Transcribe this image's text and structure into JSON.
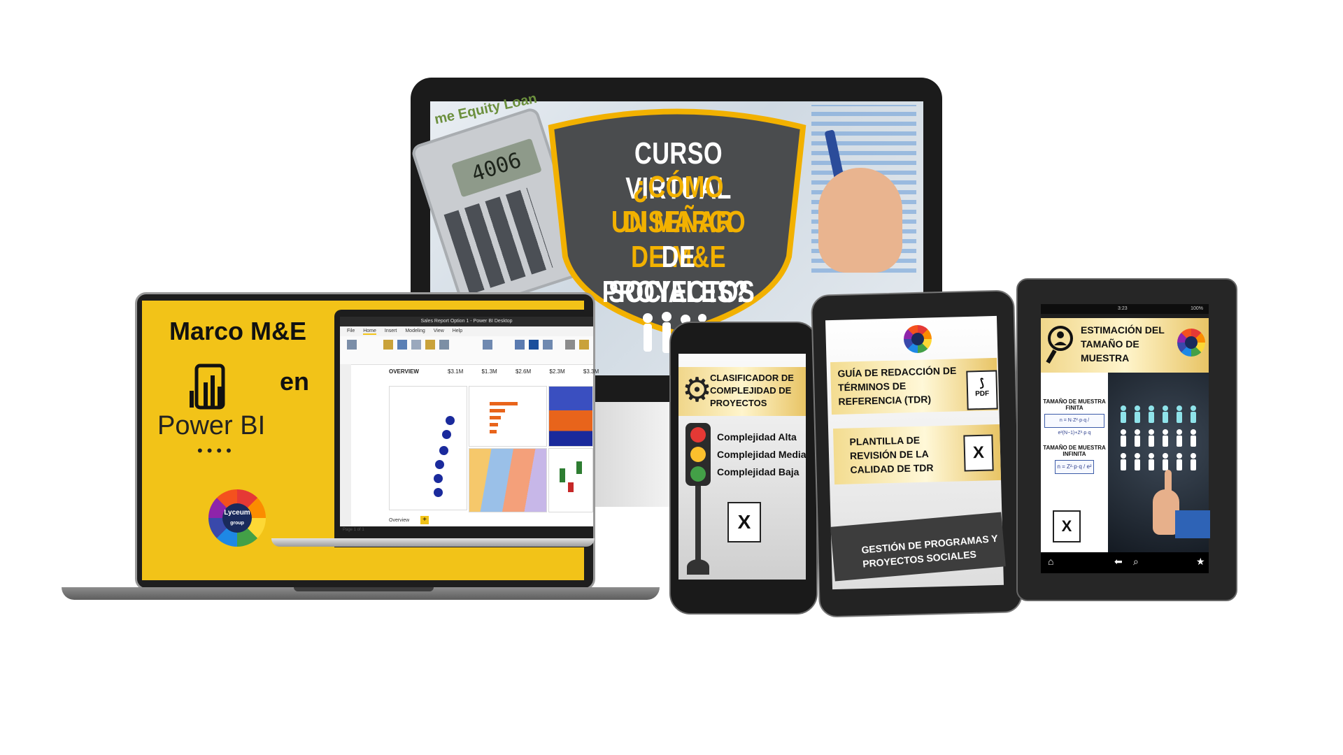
{
  "monitor": {
    "shield_lines": [
      "CURSO VIRTUAL",
      "¿CÓMO DISEÑAR",
      "UN MARCO DE M&E",
      "DE PROYECTOS",
      "SOCIALES?"
    ],
    "calculator_display": "4006",
    "background_text": "me Equity Loan"
  },
  "laptop": {
    "title": "Marco M&E",
    "connector": "en",
    "product": "Power BI",
    "dots": "••••",
    "logo_text": "Lyceum",
    "logo_subtext": "group",
    "inner_screen": {
      "window_title": "Sales Report Option 1 - Power BI Desktop",
      "tabs": [
        "File",
        "Home",
        "Insert",
        "Modeling",
        "View",
        "Help"
      ],
      "overview_label": "OVERVIEW",
      "kpis": [
        "$3.1M",
        "$1.3M",
        "$2.6M",
        "$2.3M",
        "$3.3M"
      ],
      "page_tab": "Overview",
      "page_plus": "+",
      "page_info": "Page 1 of 1"
    }
  },
  "phone": {
    "banner": "CLASIFICADOR DE COMPLEJIDAD DE PROYECTOS",
    "items": [
      "Complejidad Alta",
      "Complejidad Media",
      "Complejidad Baja"
    ],
    "excel_letter": "X"
  },
  "tablet1": {
    "item1": "GUÍA DE REDACCIÓN DE TÉRMINOS DE REFERENCIA (TDR)",
    "item2": "PLANTILLA DE REVISIÓN DE LA CALIDAD DE TDR",
    "pdf_label": "PDF",
    "excel_letter": "X",
    "footer": "GESTIÓN DE PROGRAMAS Y PROYECTOS SOCIALES"
  },
  "tablet2": {
    "status_time": "3:23",
    "status_battery": "100%",
    "banner": "ESTIMACIÓN DEL TAMAÑO DE MUESTRA",
    "label_finite": "TAMAÑO DE MUESTRA FINITA",
    "formula_finite": "n = N·Z²·p·q / e²(N−1)+Z²·p·q",
    "label_infinite": "TAMAÑO DE MUESTRA INFINITA",
    "formula_infinite": "n = Z²·p·q / e²",
    "excel_letter": "X"
  },
  "colors": {
    "brand_yellow": "#f2c318",
    "shield_gray": "#4a4c4e",
    "shield_border": "#f2b100",
    "people_cyan": "#8fe3ea"
  }
}
